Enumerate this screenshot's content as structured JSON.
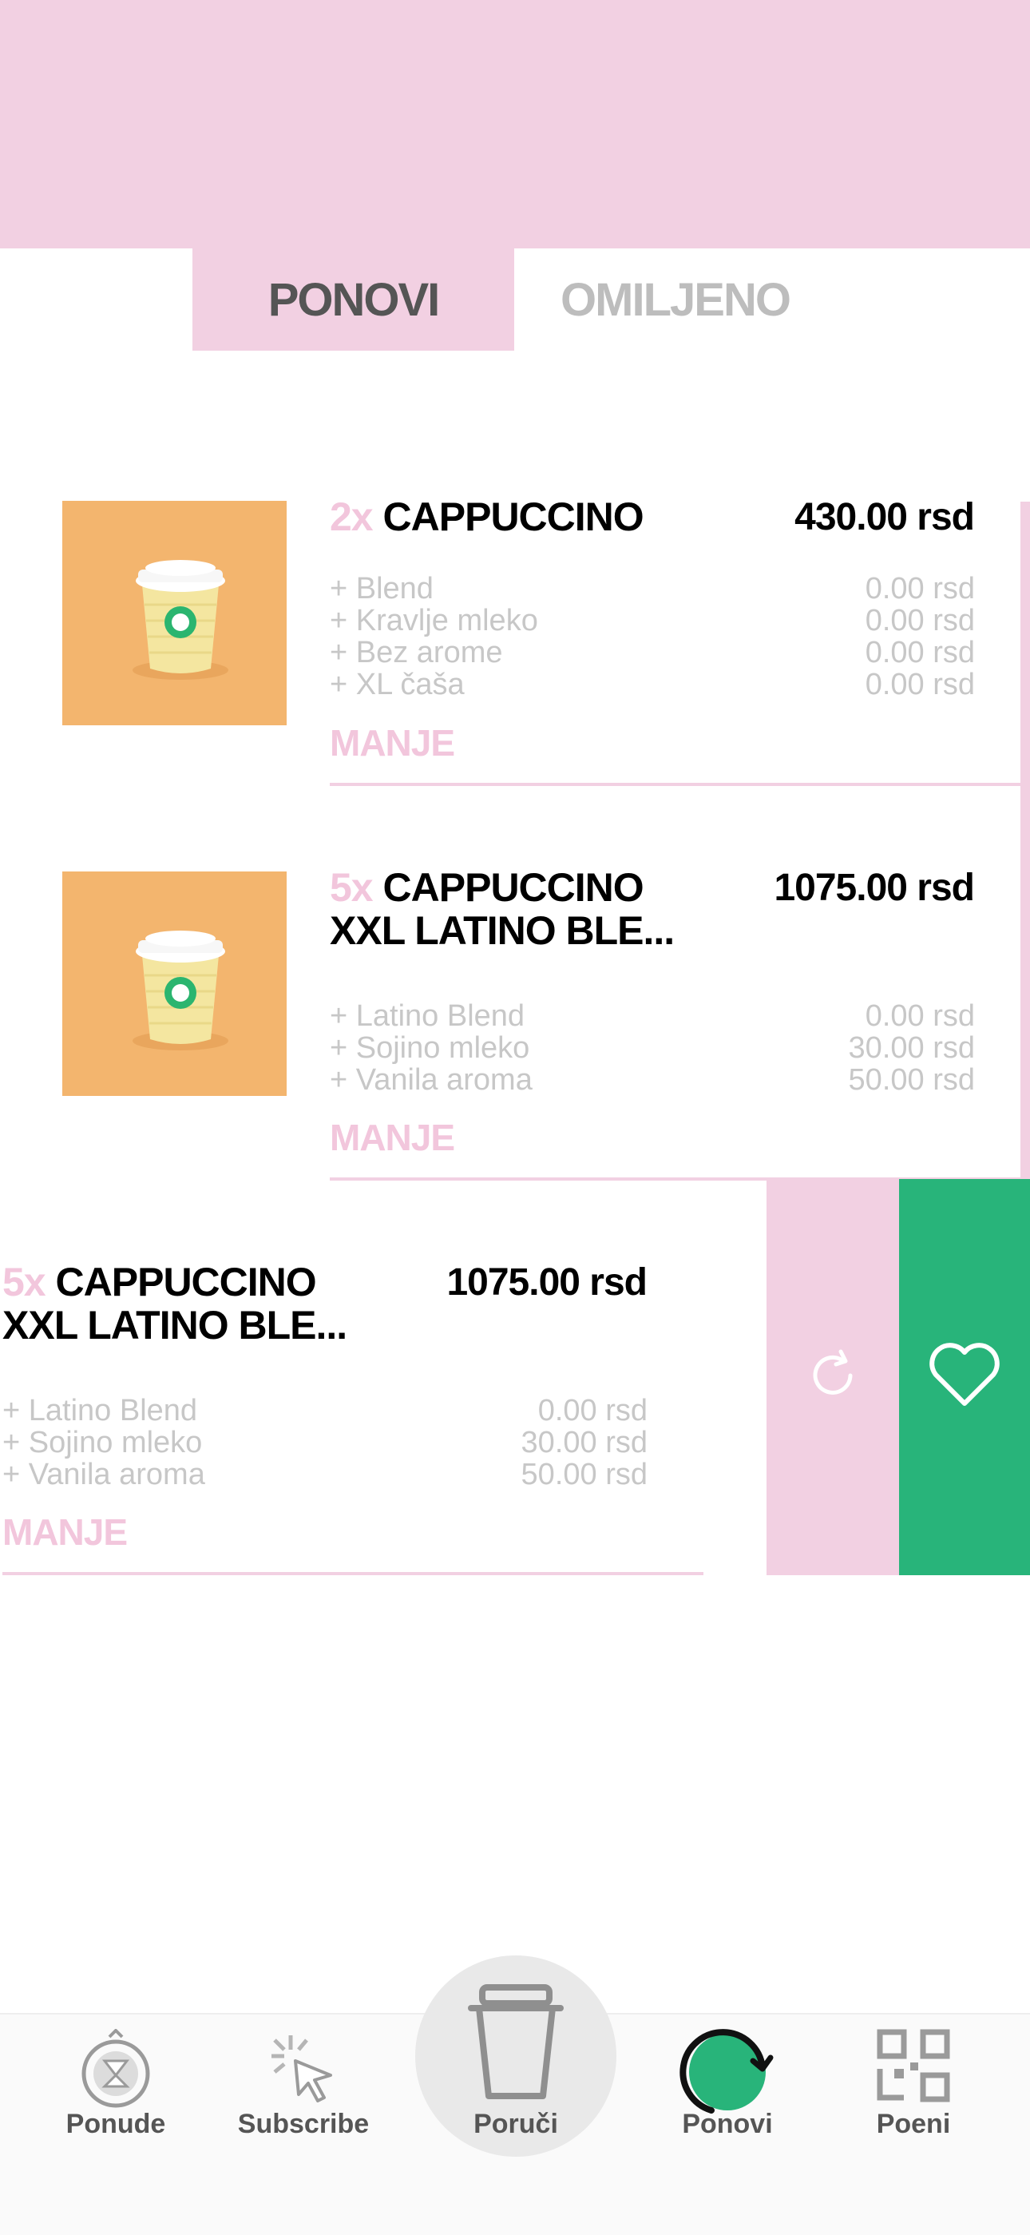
{
  "tabs": {
    "active": "PONOVI",
    "inactive": "OMILJENO"
  },
  "items": [
    {
      "qty": "2x",
      "title_line1": "CAPPUCCINO",
      "title_line2": "",
      "price": "430.00 rsd",
      "options": [
        {
          "name": "+ Blend",
          "price": "0.00 rsd"
        },
        {
          "name": "+ Kravlje mleko",
          "price": "0.00 rsd"
        },
        {
          "name": "+ Bez arome",
          "price": "0.00 rsd"
        },
        {
          "name": "+ XL čaša",
          "price": "0.00 rsd"
        }
      ],
      "toggle": "MANJE"
    },
    {
      "qty": "5x",
      "title_line1": "CAPPUCCINO",
      "title_line2": "XXL LATINO BLE...",
      "price": "1075.00 rsd",
      "options": [
        {
          "name": "+ Latino Blend",
          "price": "0.00 rsd"
        },
        {
          "name": "+ Sojino mleko",
          "price": "30.00 rsd"
        },
        {
          "name": "+ Vanila aroma",
          "price": "50.00 rsd"
        }
      ],
      "toggle": "MANJE"
    },
    {
      "qty": "5x",
      "title_line1": "CAPPUCCINO",
      "title_line2": "XXL LATINO BLE...",
      "price": "1075.00 rsd",
      "options": [
        {
          "name": "+ Latino Blend",
          "price": "0.00 rsd"
        },
        {
          "name": "+ Sojino mleko",
          "price": "30.00 rsd"
        },
        {
          "name": "+ Vanila aroma",
          "price": "50.00 rsd"
        }
      ],
      "toggle": "MANJE"
    }
  ],
  "swipe_actions": {
    "reorder_icon": "refresh-icon",
    "favorite_icon": "heart-icon"
  },
  "nav": [
    {
      "label": "Ponude",
      "icon": "hourglass-icon"
    },
    {
      "label": "Subscribe",
      "icon": "cursor-click-icon"
    },
    {
      "label": "Poruči",
      "icon": "cup-icon"
    },
    {
      "label": "Ponovi",
      "icon": "reorder-icon"
    },
    {
      "label": "Poeni",
      "icon": "qr-code-icon"
    }
  ],
  "colors": {
    "pink": "#f2d0e2",
    "green": "#28b47a",
    "grey_text": "#c7c7c7",
    "qty_pink": "#f2c6dc"
  }
}
